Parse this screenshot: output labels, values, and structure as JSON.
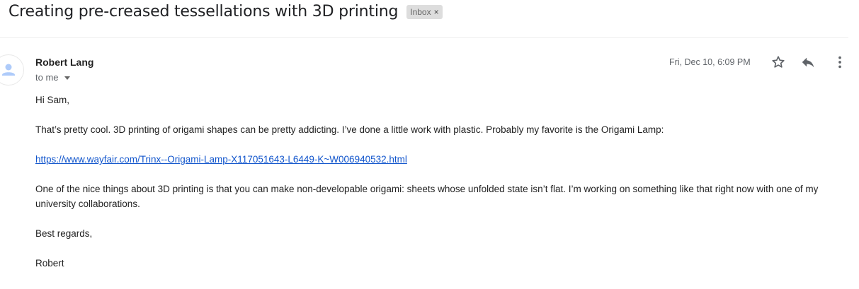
{
  "email": {
    "subject": "Creating pre-creased tessellations with 3D printing",
    "label": "Inbox",
    "label_remove": "×",
    "sender_name": "Robert Lang",
    "recipient": "to me",
    "date": "Fri, Dec 10, 6:09 PM",
    "icons": {
      "star": "star-icon",
      "reply": "reply-icon",
      "more": "more-vert-icon",
      "avatar": "person-icon",
      "dropdown": "caret-down-icon"
    },
    "body": {
      "greeting": "Hi Sam,",
      "paragraph1": "That’s pretty cool. 3D printing of origami shapes can be pretty addicting. I’ve done a little work with plastic. Probably my favorite is the Origami Lamp:",
      "link": "https://www.wayfair.com/Trinx--Origami-Lamp-X117051643-L6449-K~W006940532.html",
      "paragraph2": "One of the nice things about 3D printing is that you can make non-developable origami: sheets whose unfolded state isn’t flat. I’m working on something like that right now with one of my university collaborations.",
      "closing": "Best regards,",
      "signature": "Robert"
    }
  },
  "colors": {
    "link": "#1155cc",
    "chip_bg": "#dddddd",
    "avatar_fill": "#aecbfa"
  }
}
